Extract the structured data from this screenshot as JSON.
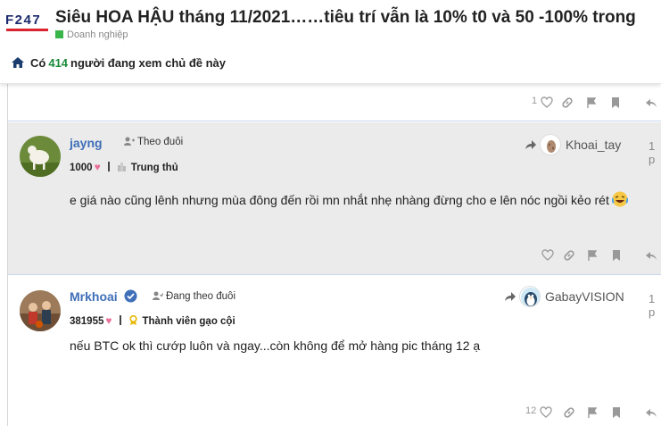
{
  "site": {
    "logo_text": "F247"
  },
  "topic": {
    "title": "Siêu HOA HẬU tháng 11/2021……tiêu trí vẫn là 10% t0 và 50 -100% trong",
    "category": "Doanh nghiệp",
    "category_color": "#3ab54a",
    "viewers": {
      "prefix": "Có",
      "count": "414",
      "suffix": "người đang xem chủ đề này"
    }
  },
  "prev_post": {
    "likes": "1"
  },
  "posts": [
    {
      "username": "jayng",
      "follow_label": "Theo đuôi",
      "score": "1000",
      "rank": "Trung thủ",
      "text": "e giá nào cũng lênh nhưng mùa đông đến rồi mn nhắt nhẹ nhàng đừng cho e lên nóc ngồi kẻo rét",
      "reply_to": "Khoai_tay",
      "date": "1 p",
      "likes": ""
    },
    {
      "username": "Mrkhoai",
      "follow_label": "Đang theo đuôi",
      "score": "381955",
      "rank": "Thành viên gạo cội",
      "text": "nếu BTC ok thì cướp luôn và ngay...còn không để mở hàng pic tháng 12 ạ",
      "reply_to": "GabayVISION",
      "date": "1 p",
      "likes": "12"
    }
  ],
  "icons": {
    "home": "home-icon",
    "like": "heart-icon",
    "link": "link-icon",
    "flag": "flag-icon",
    "bookmark": "bookmark-icon",
    "reply": "reply-icon",
    "verified": "verified-badge-icon"
  },
  "colors": {
    "username": "#3f6fb8",
    "viewer_count": "#1a8a3a",
    "highlight_bg": "#ebebeb",
    "heart": "#e8709a"
  }
}
